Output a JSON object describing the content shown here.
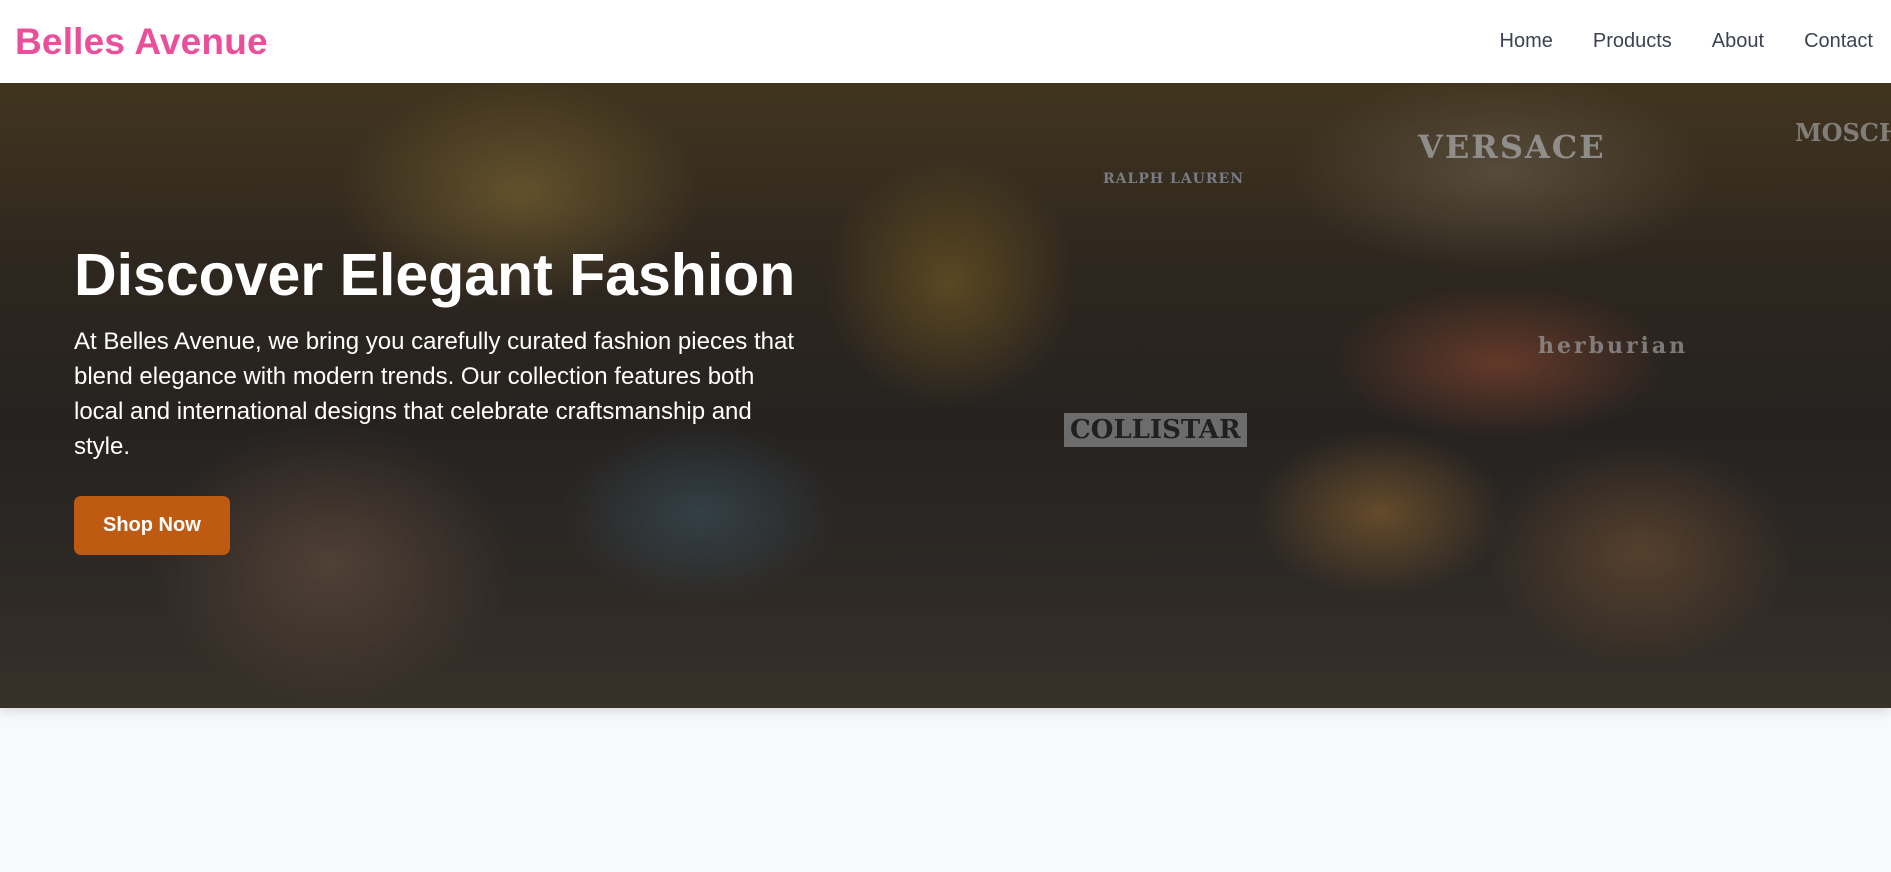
{
  "header": {
    "brand": "Belles Avenue",
    "nav": [
      {
        "label": "Home"
      },
      {
        "label": "Products"
      },
      {
        "label": "About"
      },
      {
        "label": "Contact"
      }
    ]
  },
  "hero": {
    "title": "Discover Elegant Fashion",
    "text": "At Belles Avenue, we bring you carefully curated fashion pieces that blend elegance with modern trends. Our collection features both local and international designs that celebrate craftsmanship and style.",
    "cta_label": "Shop Now",
    "image_signs": {
      "versace": "VERSACE",
      "ralph": "RALPH LAUREN",
      "collistar": "COLLISTAR",
      "moschino": "MOSCHINO",
      "herburian": "herburian"
    }
  },
  "colors": {
    "brand": "#ea4f9a",
    "cta": "#bf5a12",
    "nav_text": "#3c4350",
    "page_bg": "#f8f9fb"
  }
}
